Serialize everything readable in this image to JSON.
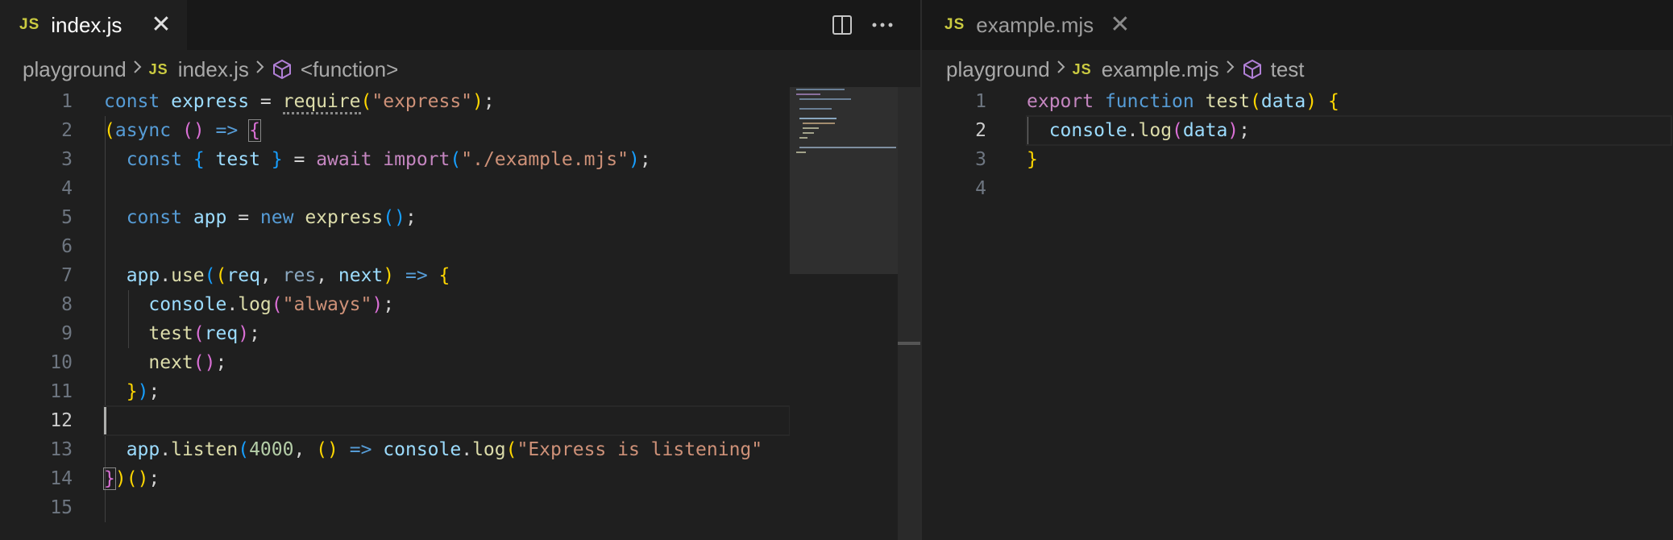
{
  "left_pane": {
    "tab": {
      "badge": "JS",
      "label": "index.js",
      "close": "✕"
    },
    "breadcrumb": {
      "folder": "playground",
      "badge": "JS",
      "file": "index.js",
      "symbol": "<function>"
    },
    "line_numbers": [
      "1",
      "2",
      "3",
      "4",
      "5",
      "6",
      "7",
      "8",
      "9",
      "10",
      "11",
      "12",
      "13",
      "14",
      "15"
    ],
    "current_line": 12,
    "code": {
      "l1": {
        "const": "const",
        "name": "express",
        "eq": " = ",
        "req": "require",
        "open": "(",
        "str": "\"express\"",
        "close": ")",
        "semi": ";"
      },
      "l2": {
        "open": "(",
        "async": "async",
        "params": "()",
        "arrow": "=>",
        "brace": "{"
      },
      "l3": {
        "const": "const",
        "ob": "{",
        "name": "test",
        "cb": "}",
        "eq": " = ",
        "await": "await",
        "import": "import",
        "open": "(",
        "str": "\"./example.mjs\"",
        "close": ")",
        "semi": ";"
      },
      "l5": {
        "const": "const",
        "name": "app",
        "eq": " = ",
        "new": "new",
        "fn": "express",
        "parens": "()",
        "semi": ";"
      },
      "l7": {
        "obj": "app",
        "dot": ".",
        "fn": "use",
        "open": "(",
        "popen": "(",
        "p1": "req",
        "c1": ", ",
        "p2": "res",
        "c2": ", ",
        "p3": "next",
        "pclose": ")",
        "arrow": "=>",
        "brace": "{"
      },
      "l8": {
        "obj": "console",
        "dot": ".",
        "fn": "log",
        "open": "(",
        "str": "\"always\"",
        "close": ")",
        "semi": ";"
      },
      "l9": {
        "fn": "test",
        "open": "(",
        "arg": "req",
        "close": ")",
        "semi": ";"
      },
      "l10": {
        "fn": "next",
        "parens": "()",
        "semi": ";"
      },
      "l11": {
        "brace": "}",
        "close": ")",
        "semi": ";"
      },
      "l13": {
        "obj": "app",
        "dot": ".",
        "fn": "listen",
        "open": "(",
        "num": "4000",
        "comma": ", ",
        "parens": "()",
        "arrow": "=>",
        "obj2": "console",
        "dot2": ".",
        "fn2": "log",
        "open2": "(",
        "str": "\"Express is listening\""
      },
      "l14": {
        "brace": "}",
        "close": ")",
        "call": "()",
        "semi": ";"
      }
    }
  },
  "right_pane": {
    "tab": {
      "badge": "JS",
      "label": "example.mjs",
      "close": "✕"
    },
    "breadcrumb": {
      "folder": "playground",
      "badge": "JS",
      "file": "example.mjs",
      "symbol": "test"
    },
    "line_numbers": [
      "1",
      "2",
      "3",
      "4"
    ],
    "current_line": 2,
    "code": {
      "l1": {
        "export": "export",
        "function": "function",
        "name": "test",
        "open": "(",
        "param": "data",
        "close": ")",
        "brace": "{"
      },
      "l2": {
        "obj": "console",
        "dot": ".",
        "fn": "log",
        "open": "(",
        "arg": "data",
        "close": ")",
        "semi": ";"
      },
      "l3": {
        "brace": "}"
      }
    }
  },
  "icons": {
    "split_editor": "split-editor-icon",
    "more_actions": "ellipsis-icon",
    "chevron": "chevron-right-icon",
    "symbol": "symbol-cube-icon"
  },
  "colors": {
    "background": "#1f1f1f",
    "tab_bar": "#181818",
    "js_badge": "#cbcb41",
    "keyword": "#569cd6",
    "control": "#c586c0",
    "function": "#dcdcaa",
    "variable": "#9cdcfe",
    "string": "#ce9178",
    "number": "#b5cea8"
  }
}
